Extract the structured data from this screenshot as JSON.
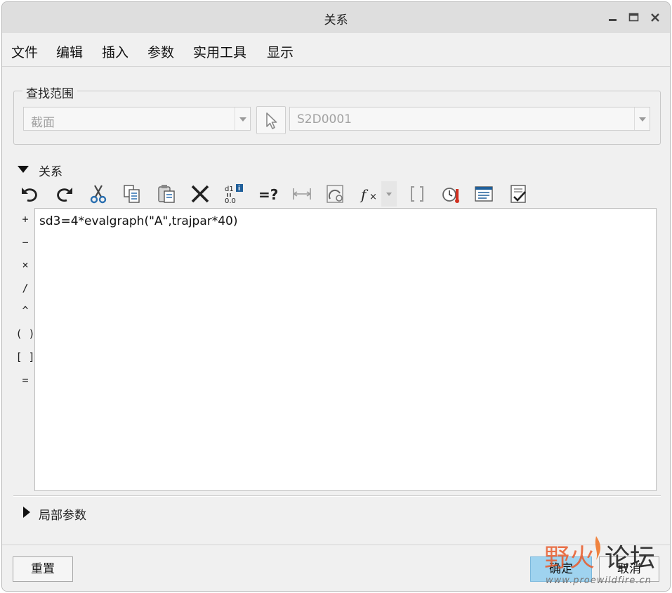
{
  "window": {
    "title": "关系"
  },
  "menu": [
    "文件",
    "编辑",
    "插入",
    "参数",
    "实用工具",
    "显示"
  ],
  "lookup": {
    "group_label": "查找范围",
    "type_value": "截面",
    "name_value": "S2D0001"
  },
  "relations": {
    "section_label": "关系",
    "expanded": true,
    "toolbar_icons": [
      "undo-icon",
      "redo-icon",
      "cut-icon",
      "copy-icon",
      "paste-icon",
      "delete-icon",
      "switch-dimensions-icon",
      "evaluate-icon",
      "show-dimension-icon",
      "insert-parameter-icon",
      "insert-function-icon",
      "insert-function-dropdown-icon",
      "brackets-icon",
      "unit-sensitive-icon",
      "sort-relations-icon",
      "verify-relations-icon"
    ],
    "operators": [
      "+",
      "−",
      "×",
      "/",
      "^",
      "( )",
      "[ ]",
      "="
    ],
    "editor_text": "sd3=4*evalgraph(\"A\",trajpar*40)"
  },
  "local_params": {
    "section_label": "局部参数",
    "expanded": false
  },
  "buttons": {
    "reset": "重置",
    "ok": "确定",
    "cancel": "取消"
  },
  "watermark": {
    "brand": "野火论坛",
    "brand_part1": "野火",
    "brand_part2": "论坛",
    "url": "www.proewildfire.cn"
  },
  "colors": {
    "window_bg": "#f0f0f0",
    "titlebar_bg": "#dedede",
    "primary_button": "#9fd3ef",
    "watermark_accent": "#e85a2a"
  }
}
